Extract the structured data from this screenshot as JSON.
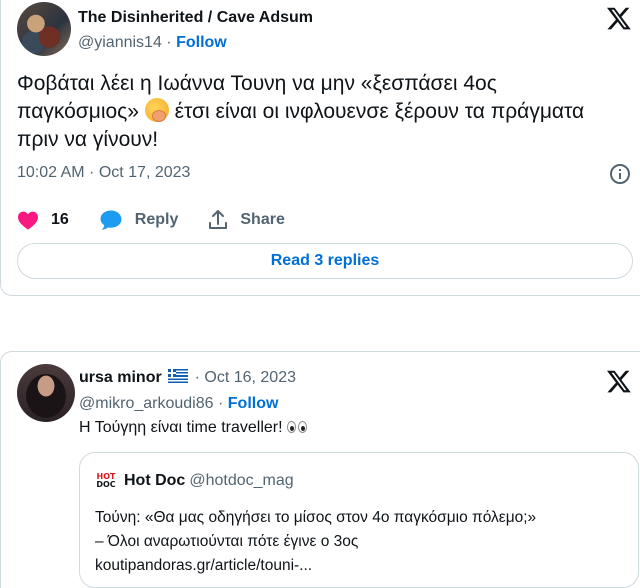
{
  "tweet1": {
    "author_name": "The Disinherited / Cave Adsum",
    "handle": "@yiannis14",
    "separator": "·",
    "follow_label": "Follow",
    "text_before_emoji": "Φοβάται λέει η Ιωάννα Τουνη να μην «ξεσπάσει 4ος παγκόσμιος»",
    "emoji_name": "yawning-face-emoji",
    "text_after_emoji": " έτσι είναι οι ινφλουενσε ξέρουν τα πράγματα πριν να γίνουν!",
    "timestamp": "10:02 AM · Oct 17, 2023",
    "actions": {
      "like_count": "16",
      "reply_label": "Reply",
      "share_label": "Share"
    },
    "read_replies_label": "Read 3 replies",
    "colors": {
      "like": "#f91880",
      "reply": "#1d9bf0",
      "link": "#006fd6"
    }
  },
  "tweet2": {
    "author_name": "ursa minor",
    "flag": "greece-flag",
    "separator": "·",
    "date": "Oct 16, 2023",
    "handle": "@mikro_arkoudi86",
    "follow_label": "Follow",
    "text": "Η Τούγηη είναι time traveller! ",
    "emoji_name": "eyes-emoji",
    "quote": {
      "logo_line1": "HOT",
      "logo_line2": "DOC",
      "name": "Hot Doc",
      "handle": "@hotdoc_mag",
      "line1": "Τούνη: «Θα μας οδηγήσει το μίσος στον 4ο παγκόσμιο πόλεμο;»",
      "line2": "– Όλοι αναρωτιούνται πότε έγινε ο 3ος",
      "line3": "koutipandoras.gr/article/touni-..."
    }
  }
}
